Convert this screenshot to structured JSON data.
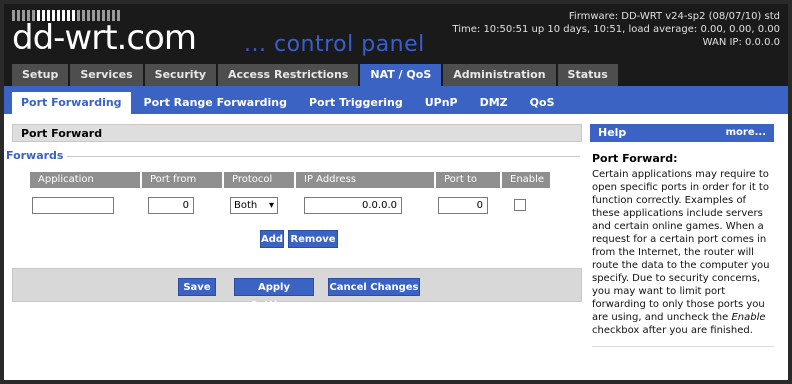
{
  "header": {
    "logo": "dd-wrt.com",
    "subtitle": "... control panel",
    "firmware": "Firmware: DD-WRT v24-sp2 (08/07/10) std",
    "time": "Time: 10:50:51 up 10 days, 10:51, load average: 0.00, 0.00, 0.00",
    "wan_ip": "WAN IP: 0.0.0.0"
  },
  "top_tabs": [
    {
      "label": "Setup"
    },
    {
      "label": "Services"
    },
    {
      "label": "Security"
    },
    {
      "label": "Access Restrictions"
    },
    {
      "label": "NAT / QoS",
      "active": true
    },
    {
      "label": "Administration"
    },
    {
      "label": "Status"
    }
  ],
  "sub_tabs": [
    {
      "label": "Port Forwarding",
      "active": true
    },
    {
      "label": "Port Range Forwarding"
    },
    {
      "label": "Port Triggering"
    },
    {
      "label": "UPnP"
    },
    {
      "label": "DMZ"
    },
    {
      "label": "QoS"
    }
  ],
  "main": {
    "section_title": "Port Forward",
    "legend": "Forwards",
    "columns": [
      "Application",
      "Port from",
      "Protocol",
      "IP Address",
      "Port to",
      "Enable"
    ],
    "row": {
      "application": "",
      "port_from": "0",
      "protocol": "Both",
      "ip_address": "0.0.0.0",
      "port_to": "0",
      "enable": false
    },
    "add_label": "Add",
    "remove_label": "Remove",
    "save_label": "Save",
    "apply_label": "Apply Settings",
    "cancel_label": "Cancel Changes"
  },
  "help": {
    "title": "Help",
    "more": "more...",
    "heading": "Port Forward:",
    "text_before": "Certain applications may require to open specific ports in order for it to function correctly. Examples of these applications include servers and certain online games. When a request for a certain port comes in from the Internet, the router will route the data to the computer you specify. Due to security concerns, you may want to limit port forwarding to only those ports you are using, and uncheck the ",
    "text_em": "Enable",
    "text_after": " checkbox after you are finished."
  },
  "colors": {
    "accent": "#3a63c4",
    "header_bg": "#1a1a1a",
    "tab_bg": "#4e4e4e"
  }
}
